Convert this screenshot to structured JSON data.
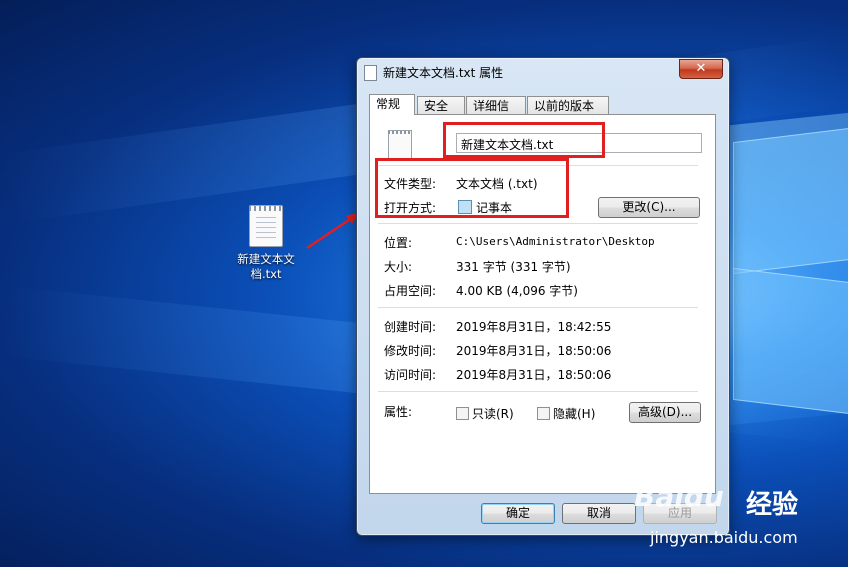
{
  "desktop": {
    "file_icon_label": "新建文本文\n档.txt"
  },
  "dialog": {
    "title": "新建文本文档.txt 属性",
    "close_label": "✕",
    "tabs": [
      "常规",
      "安全",
      "详细信息",
      "以前的版本"
    ],
    "active_tab": "常规",
    "file_name_value": "新建文本文档.txt",
    "file_type_label": "文件类型:",
    "file_type_value": "文本文档 (.txt)",
    "open_with_label": "打开方式:",
    "open_with_value": "记事本",
    "change_button": "更改(C)...",
    "location_label": "位置:",
    "location_value": "C:\\Users\\Administrator\\Desktop",
    "size_label": "大小:",
    "size_value": "331 字节 (331 字节)",
    "disk_size_label": "占用空间:",
    "disk_size_value": "4.00 KB (4,096 字节)",
    "created_label": "创建时间:",
    "created_value": "2019年8月31日，18:42:55",
    "modified_label": "修改时间:",
    "modified_value": "2019年8月31日，18:50:06",
    "accessed_label": "访问时间:",
    "accessed_value": "2019年8月31日，18:50:06",
    "attributes_label": "属性:",
    "readonly_label": "只读(R)",
    "hidden_label": "隐藏(H)",
    "advanced_button": "高级(D)...",
    "ok_button": "确定",
    "cancel_button": "取消",
    "apply_button": "应用"
  },
  "watermark": {
    "brand": "Baidu",
    "jingyan": "经验",
    "url": "jingyan.baidu.com"
  },
  "colors": {
    "highlight_box": "#e02020",
    "desktop_blue": "#0b4fb8"
  }
}
